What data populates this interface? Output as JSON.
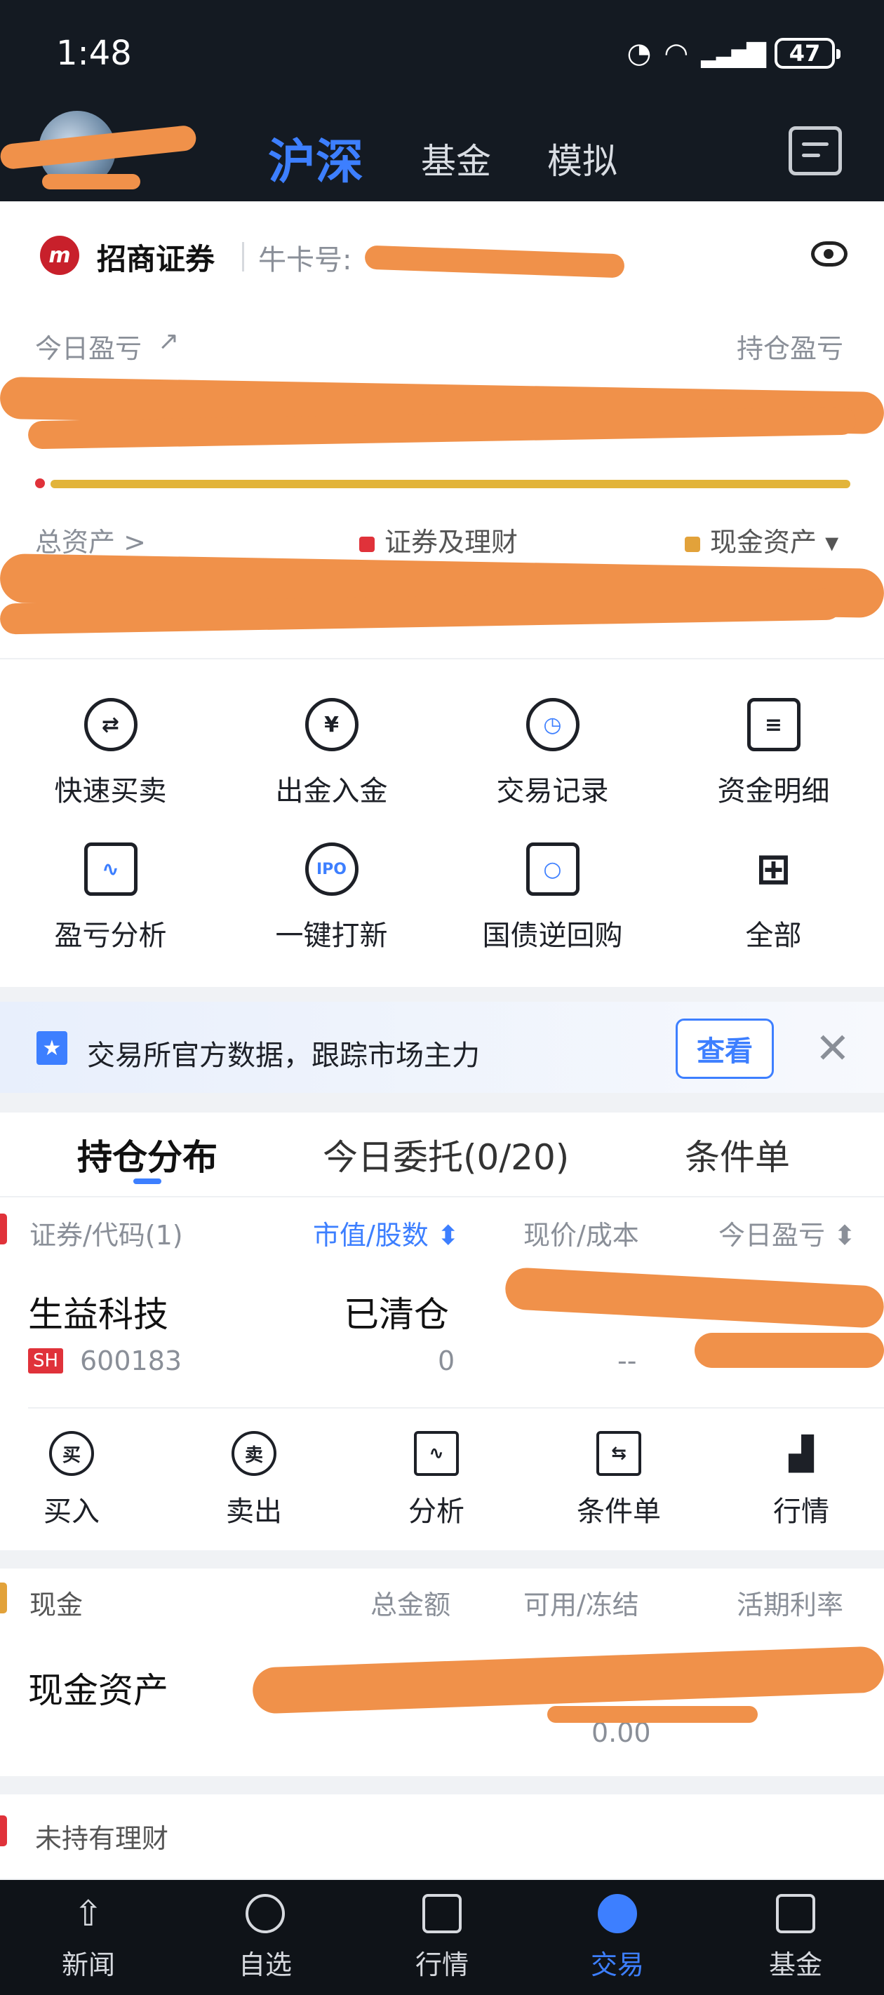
{
  "status_bar": {
    "time": "1:48",
    "battery": "47"
  },
  "header": {
    "tabs": [
      {
        "label": "沪深",
        "active": true
      },
      {
        "label": "基金",
        "active": false
      },
      {
        "label": "模拟",
        "active": false
      }
    ]
  },
  "account": {
    "broker_logo": "m",
    "broker_name": "招商证券",
    "card_label": "牛卡号:",
    "today_pl_label": "今日盈亏",
    "position_pl_label": "持仓盈亏",
    "total_assets_label": "总资产 >",
    "legend": [
      {
        "label": "证券及理财",
        "color": "#e0323a"
      },
      {
        "label": "现金资产 ▾",
        "color": "#e2a23a"
      }
    ]
  },
  "quick_actions": [
    {
      "label": "快速买卖",
      "icon": "swap-icon"
    },
    {
      "label": "出金入金",
      "icon": "yuan-transfer-icon"
    },
    {
      "label": "交易记录",
      "icon": "clock-icon"
    },
    {
      "label": "资金明细",
      "icon": "clipboard-icon"
    },
    {
      "label": "盈亏分析",
      "icon": "monitor-chart-icon"
    },
    {
      "label": "一键打新",
      "icon": "ipo-icon",
      "icon_text": "IPO"
    },
    {
      "label": "国债逆回购",
      "icon": "ticket-icon"
    },
    {
      "label": "全部",
      "icon": "grid-icon"
    }
  ],
  "banner": {
    "text": "交易所官方数据，跟踪市场主力",
    "button": "查看",
    "close": "✕"
  },
  "holdings": {
    "tabs": [
      "持仓分布",
      "今日委托(0/20)",
      "条件单"
    ],
    "columns": [
      "证券/代码(1)",
      "市值/股数 ⬍",
      "现价/成本",
      "今日盈亏 ⬍"
    ],
    "rows": [
      {
        "name": "生益科技",
        "market": "SH",
        "code": "600183",
        "status": "已清仓",
        "shares": "0",
        "price": "--"
      }
    ],
    "actions": [
      {
        "label": "买入",
        "icon_text": "买"
      },
      {
        "label": "卖出",
        "icon_text": "卖"
      },
      {
        "label": "分析",
        "icon_text": ""
      },
      {
        "label": "条件单",
        "icon_text": ""
      },
      {
        "label": "行情",
        "icon_text": ""
      }
    ]
  },
  "cash": {
    "title": "现金",
    "columns": [
      "总金额",
      "可用/冻结",
      "活期利率"
    ],
    "row_name": "现金资产",
    "frozen": "0.00"
  },
  "no_finance": {
    "text": "未持有理财"
  },
  "bottom_nav": [
    {
      "label": "新闻",
      "active": false
    },
    {
      "label": "自选",
      "active": false
    },
    {
      "label": "行情",
      "active": false
    },
    {
      "label": "交易",
      "active": true
    },
    {
      "label": "基金",
      "active": false
    }
  ]
}
